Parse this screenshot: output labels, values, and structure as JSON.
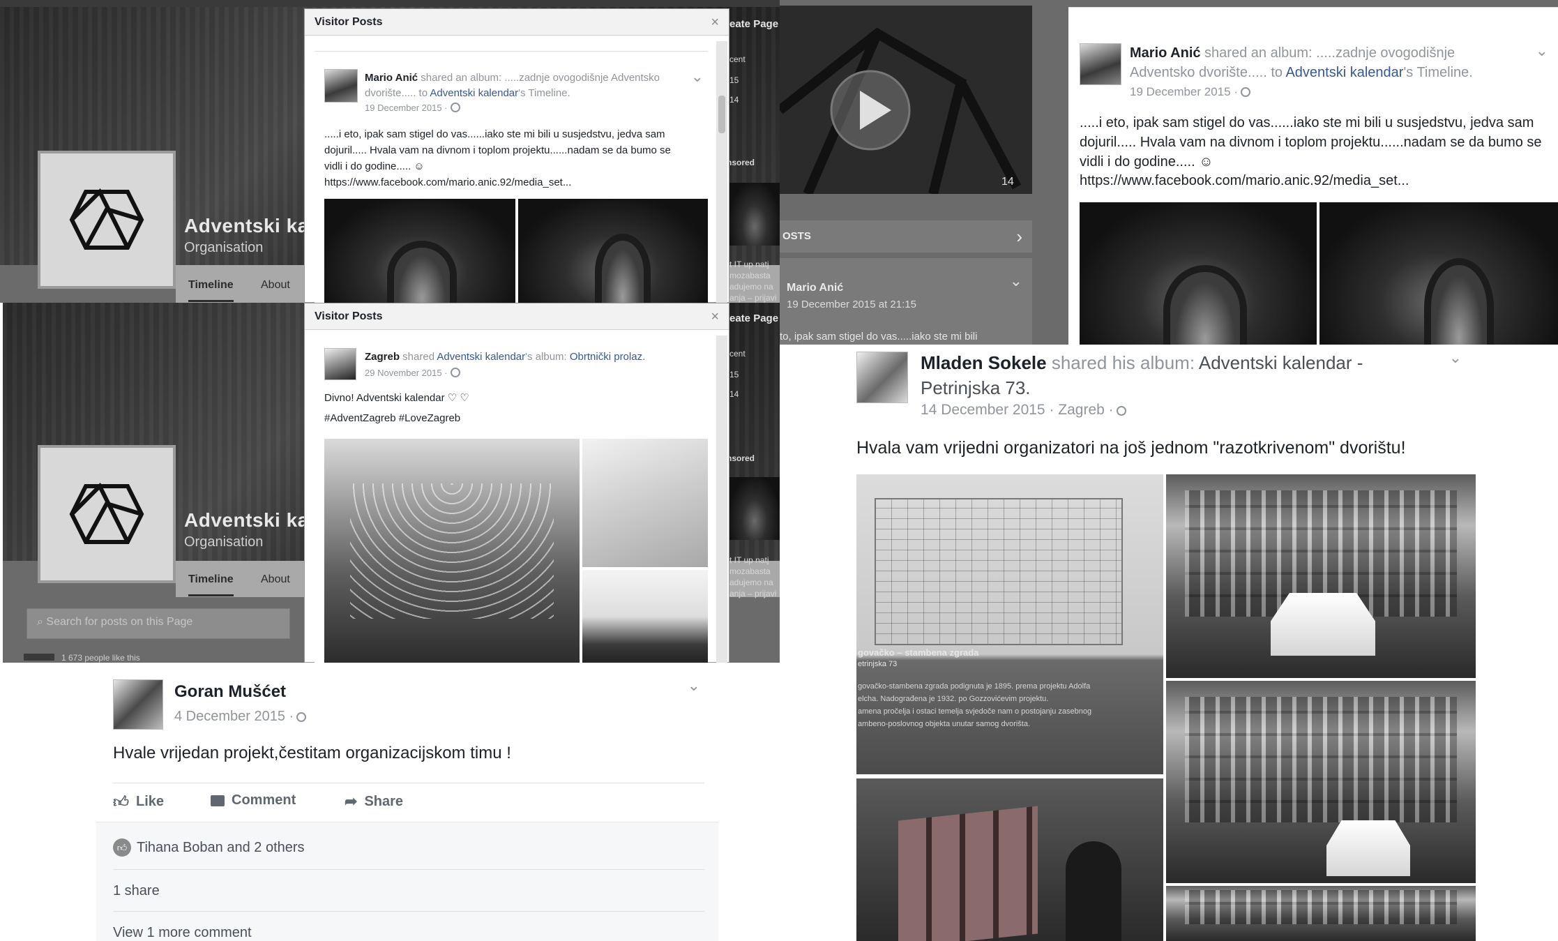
{
  "page": {
    "name": "Adventski ka",
    "category": "Organisation",
    "tabs": [
      "Timeline",
      "About"
    ],
    "create_page_label": "eate Page",
    "search_placeholder": "Search for posts on this Page",
    "likes_text": "1 673 people like this"
  },
  "modal": {
    "title": "Visitor Posts",
    "close": "×"
  },
  "side_fragments": {
    "recent": "cent",
    "a": "15",
    "b": "14",
    "sponsored": "nsored",
    "ad_text_1": "t IT up natj",
    "ad_text_2": "mozabasta",
    "ad_text_3": "adujemo na",
    "ad_text_4": "anja – prijavi",
    "posts_header": "OSTS",
    "video_likes": "14",
    "visitor_name": "Mario Anić",
    "visitor_date": "19 December 2015 at 21:15",
    "visitor_snippet": "to, ipak sam stigel do vas.....iako ste mi bili"
  },
  "post_mario": {
    "author": "Mario Anić",
    "action_text": " shared an album: .....zadnje ovogodišnje Adventsko dvorište..... to ",
    "target": "Adventski kalendar",
    "target_suffix": "'s Timeline.",
    "date": "19 December 2015 ·",
    "text": ".....i eto, ipak sam stigel do vas......iako ste mi bili u susjedstvu, jedva sam dojuril..... Hvala vam na divnom i toplom projektu......nadam se da bumo se vidli i do godine..... ☺",
    "link": "https://www.facebook.com/mario.anic.92/media_set..."
  },
  "post_zagreb": {
    "author": "Zagreb",
    "action_text": " shared ",
    "target": "Adventski kalendar",
    "target_suffix": "'s album: ",
    "album": "Obrtnički prolaz.",
    "date": "29 November 2015 ·",
    "text": "Divno! Adventski kalendar ♡ ♡",
    "hashtags": "#AdventZagreb #LoveZagreb"
  },
  "post_goran": {
    "author": "Goran Mušćet",
    "date": "4 December 2015 ·",
    "text": "Hvale vrijedan projekt,čestitam organizacijskom timu !",
    "like": "Like",
    "comment": "Comment",
    "share": "Share",
    "reactions": "Tihana Boban and 2 others",
    "shares": "1 share",
    "more_comments": "View 1 more comment"
  },
  "post_mladen": {
    "author": "Mladen Sokele",
    "action_text": " shared his album: ",
    "album": "Adventski kalendar - Petrinjska 73.",
    "date": "14 December 2015 · Zagreb ·",
    "text": "Hvala vam vrijedni organizatori na još jednom \"razotkrivenom\" dvorištu!",
    "plan_caption_1": "govačko – stambena zgrada",
    "plan_caption_2": "etrinjska 73",
    "plan_caption_3": "govačko-stambena zgrada podignuta je 1895. prema projektu Adolfa",
    "plan_caption_4": "elcha. Nadograđena je 1932. po Gozzovićevim projektu.",
    "plan_caption_5": "amena pročelja i ostaci temelja svjedoče nam o postojanju zasebnog",
    "plan_caption_6": "ambeno-poslovnog objekta unutar samog dvorišta."
  },
  "colors": {
    "link": "#365899",
    "muted": "#90949c",
    "text": "#1d2129"
  }
}
